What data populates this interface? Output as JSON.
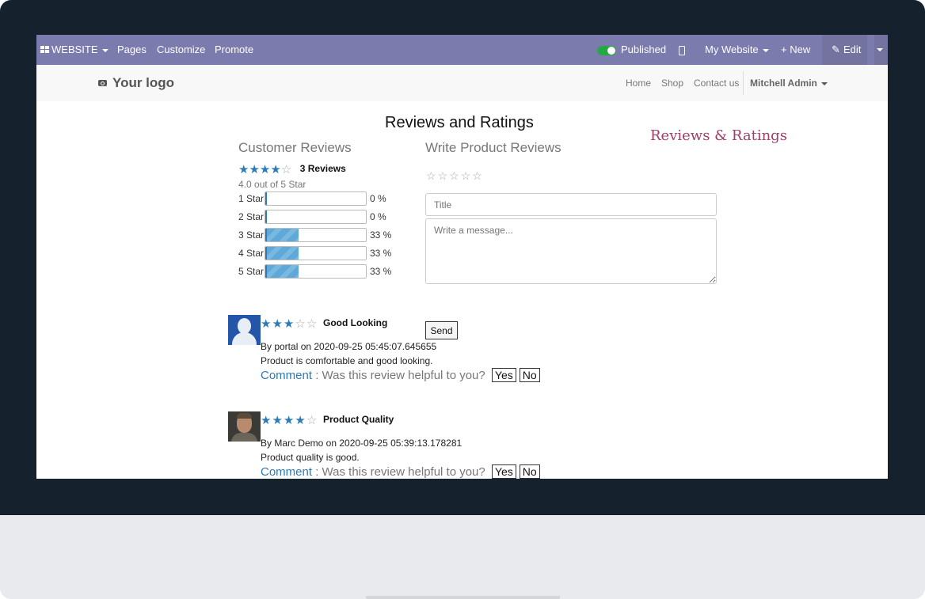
{
  "admin_bar": {
    "website_label": "WEBSITE",
    "pages": "Pages",
    "customize": "Customize",
    "promote": "Promote",
    "published": "Published",
    "my_website": "My Website",
    "new": "+ New",
    "edit": "Edit"
  },
  "topnav": {
    "logo": "Your logo",
    "links": [
      "Home",
      "Shop",
      "Contact us"
    ],
    "user": "Mitchell Admin"
  },
  "page": {
    "title": "Reviews and Ratings",
    "snippet_title": "Reviews & Ratings"
  },
  "customer_reviews": {
    "heading": "Customer Reviews",
    "rating_stars": 4,
    "review_count": "3 Reviews",
    "summary": "4.0 out of 5 Star",
    "breakdown": [
      {
        "label": "1 Star",
        "percent": 0,
        "text": "0 %"
      },
      {
        "label": "2 Star",
        "percent": 0,
        "text": "0 %"
      },
      {
        "label": "3 Star",
        "percent": 33,
        "text": "33 %"
      },
      {
        "label": "4 Star",
        "percent": 33,
        "text": "33 %"
      },
      {
        "label": "5 Star",
        "percent": 33,
        "text": "33 %"
      }
    ]
  },
  "write_review": {
    "heading": "Write Product Reviews",
    "title_placeholder": "Title",
    "message_placeholder": "Write a message...",
    "send": "Send"
  },
  "reviews": [
    {
      "title": "Good Looking",
      "stars": 3,
      "byline": "By portal on 2020-09-25 05:45:07.645655",
      "body": "Product is comfortable and good looking.",
      "comment": "Comment",
      "helpful": ": Was this review helpful to you?",
      "yes": "Yes",
      "no": "No"
    },
    {
      "title": "Product Quality",
      "stars": 4,
      "byline": "By Marc Demo on 2020-09-25 05:39:13.178281",
      "body": "Product quality is good.",
      "comment": "Comment",
      "helpful": ": Was this review helpful to you?",
      "yes": "Yes",
      "no": "No"
    }
  ],
  "colors": {
    "admin_bar": "#7c7bad",
    "star_filled": "#2c7bb6",
    "accent_title": "#a03d6a"
  }
}
